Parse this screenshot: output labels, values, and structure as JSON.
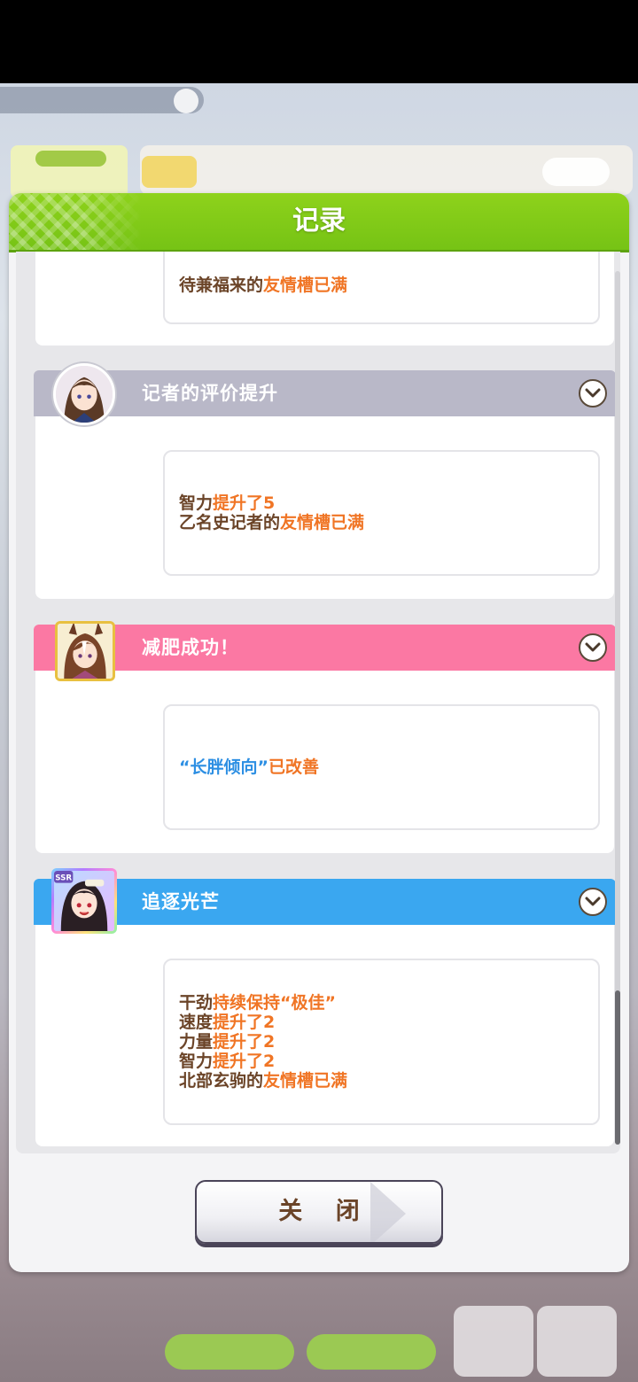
{
  "dialog": {
    "title": "记录",
    "close_label": "关 闭"
  },
  "records": [
    {
      "title": "",
      "lines": [
        [
          {
            "t": "待兼福来的",
            "c": "brown"
          },
          {
            "t": "友情槽已满",
            "c": "orange"
          }
        ]
      ]
    },
    {
      "title": "记者的评价提升",
      "header_color": "#b9b8c8",
      "avatar": "reporter-portrait",
      "lines": [
        [
          {
            "t": "智力",
            "c": "brown"
          },
          {
            "t": "提升了5",
            "c": "orange"
          }
        ],
        [
          {
            "t": "乙名史记者的",
            "c": "brown"
          },
          {
            "t": "友情槽已满",
            "c": "orange"
          }
        ]
      ]
    },
    {
      "title": "减肥成功！",
      "header_color": "#fb78a3",
      "avatar": "umamusume-portrait",
      "lines": [
        [
          {
            "t": "“长胖倾向”",
            "c": "blue"
          },
          {
            "t": "已改善",
            "c": "orange"
          }
        ]
      ]
    },
    {
      "title": "追逐光芒",
      "header_color": "#3aa7f0",
      "avatar": "ssr-support-card",
      "avatar_badge": "SSR",
      "lines": [
        [
          {
            "t": "干劲",
            "c": "brown"
          },
          {
            "t": "持续保持“极佳”",
            "c": "orange"
          }
        ],
        [
          {
            "t": "速度",
            "c": "brown"
          },
          {
            "t": "提升了2",
            "c": "orange"
          }
        ],
        [
          {
            "t": "力量",
            "c": "brown"
          },
          {
            "t": "提升了2",
            "c": "orange"
          }
        ],
        [
          {
            "t": "智力",
            "c": "brown"
          },
          {
            "t": "提升了2",
            "c": "orange"
          }
        ],
        [
          {
            "t": "北部玄驹的",
            "c": "brown"
          },
          {
            "t": "友情槽已满",
            "c": "orange"
          }
        ]
      ]
    }
  ],
  "colors": {
    "header_green": "#82cc18",
    "text_brown": "#6b4428",
    "text_orange": "#f07525",
    "text_blue": "#2d8fe3"
  }
}
